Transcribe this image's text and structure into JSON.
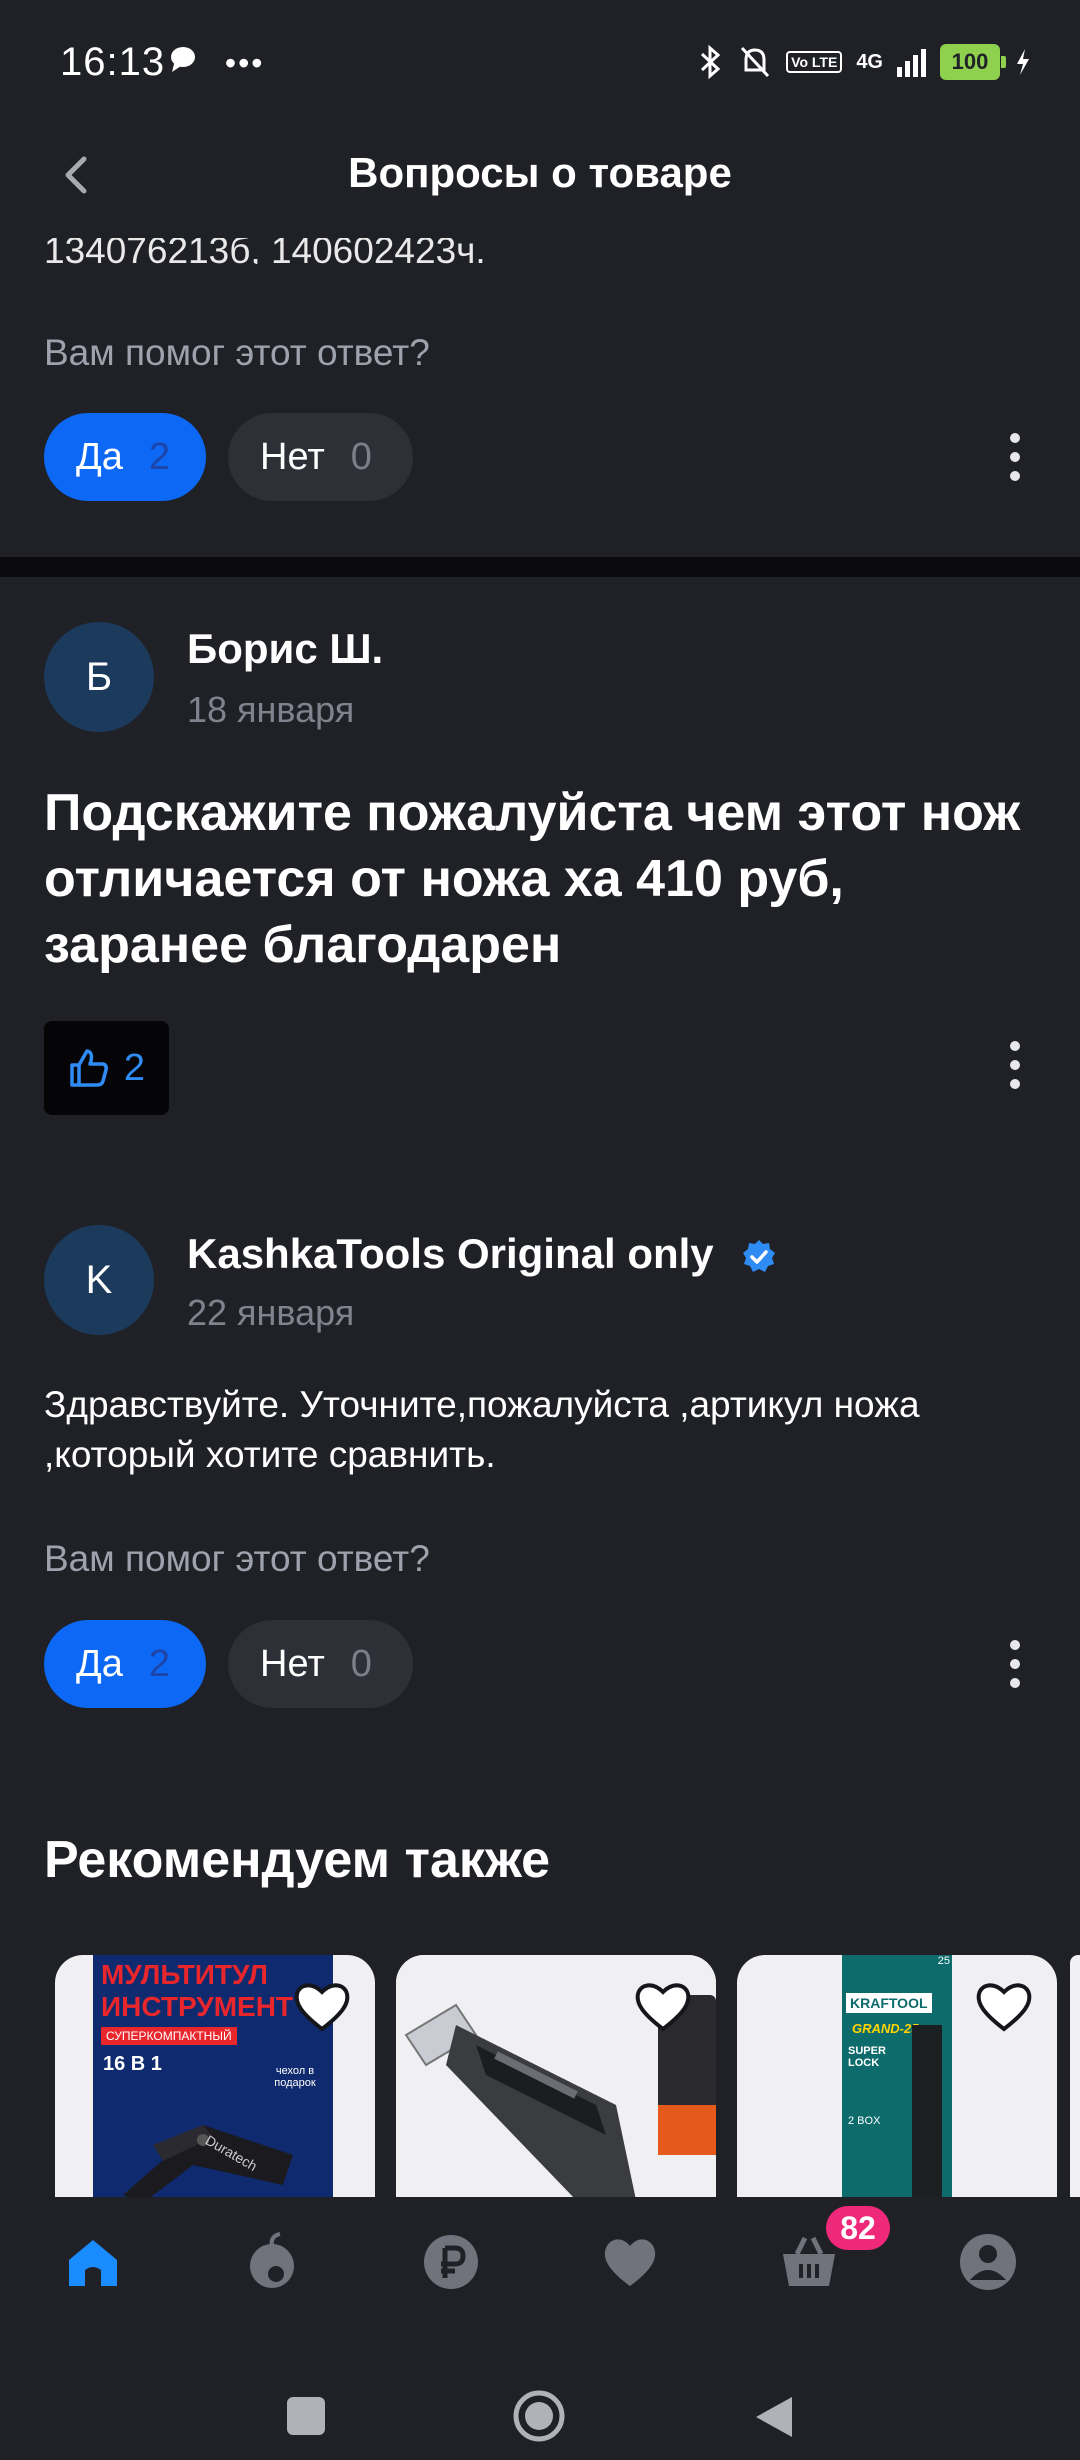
{
  "status_bar": {
    "time": "16:13",
    "battery": "100",
    "network": "4G",
    "volte": "Vo LTE"
  },
  "header": {
    "title": "Вопросы о товаре"
  },
  "first_answer": {
    "cut_text": "134076213б, 140602423ч.",
    "helpful_prompt": "Вам помог этот ответ?",
    "yes_label": "Да",
    "yes_count": "2",
    "no_label": "Нет",
    "no_count": "0"
  },
  "question": {
    "author_initial": "Б",
    "author_name": "Борис Ш.",
    "date": "18 января",
    "text": "Подскажите пожалуйста чем этот нож отличается от ножа ха 410 руб, заранее благодарен",
    "likes": "2"
  },
  "answer": {
    "author_initial": "K",
    "author_name": "KashkaTools Original only",
    "date": "22 января",
    "text": "Здравствуйте. Уточните,пожалуйста ,артикул ножа ,который хотите сравнить.",
    "helpful_prompt": "Вам помог этот ответ?",
    "yes_label": "Да",
    "yes_count": "2",
    "no_label": "Нет",
    "no_count": "0"
  },
  "recommended": {
    "title": "Рекомендуем также",
    "cards": [
      {
        "line1": "МУЛЬТИТУЛ",
        "line2": "ИНСТРУМЕНТ",
        "tag": "СУПЕРКОМПАКТНЫЙ",
        "badge": "16 В 1",
        "gift": "чехол в подарок",
        "brand": "Duratech"
      },
      {
        "name": "knife"
      },
      {
        "brand": "KRAFTOOL",
        "model": "GRAND-25",
        "lock": "SUPER LOCK",
        "box": "2 BOX",
        "number": "25"
      }
    ]
  },
  "bottom_nav": {
    "items": [
      "home-icon",
      "catalog-icon",
      "payment-icon",
      "favorites-icon",
      "cart-icon",
      "profile-icon"
    ],
    "cart_badge": "82"
  },
  "colors": {
    "accent": "#0c68f5",
    "badge": "#f0287a",
    "background": "#1f2127"
  }
}
